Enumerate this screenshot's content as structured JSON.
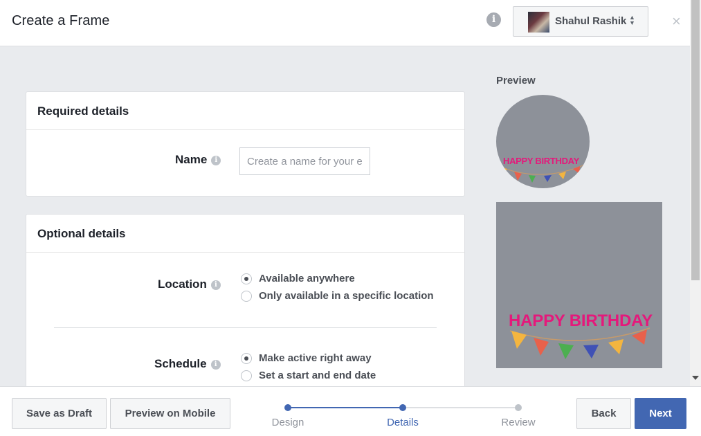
{
  "header": {
    "title": "Create a Frame",
    "info_icon": "i",
    "account_name": "Shahul Rashik",
    "sort_icon": "⬍",
    "close_icon": "×"
  },
  "required": {
    "heading": "Required details",
    "name_label": "Name",
    "name_placeholder": "Create a name for your e"
  },
  "optional": {
    "heading": "Optional details",
    "location_label": "Location",
    "location_options": [
      "Available anywhere",
      "Only available in a specific location"
    ],
    "location_selected": "Available anywhere",
    "schedule_label": "Schedule",
    "schedule_options": [
      "Make active right away",
      "Set a start and end date"
    ],
    "schedule_selected": "Make active right away"
  },
  "preview": {
    "label": "Preview",
    "banner_text": "HAPPY BIRTHDAY",
    "bunting_colors": [
      "#f4b53f",
      "#e8614b",
      "#4caf50",
      "#3f51b5",
      "#f4b53f",
      "#e8614b"
    ]
  },
  "footer": {
    "save_draft": "Save as Draft",
    "preview_mobile": "Preview on Mobile",
    "steps": [
      "Design",
      "Details",
      "Review"
    ],
    "active_step": "Details",
    "back": "Back",
    "next": "Next"
  },
  "colors": {
    "accent": "#4267b2",
    "frame_pink": "#e4197b",
    "frame_bg": "#8d9199"
  }
}
